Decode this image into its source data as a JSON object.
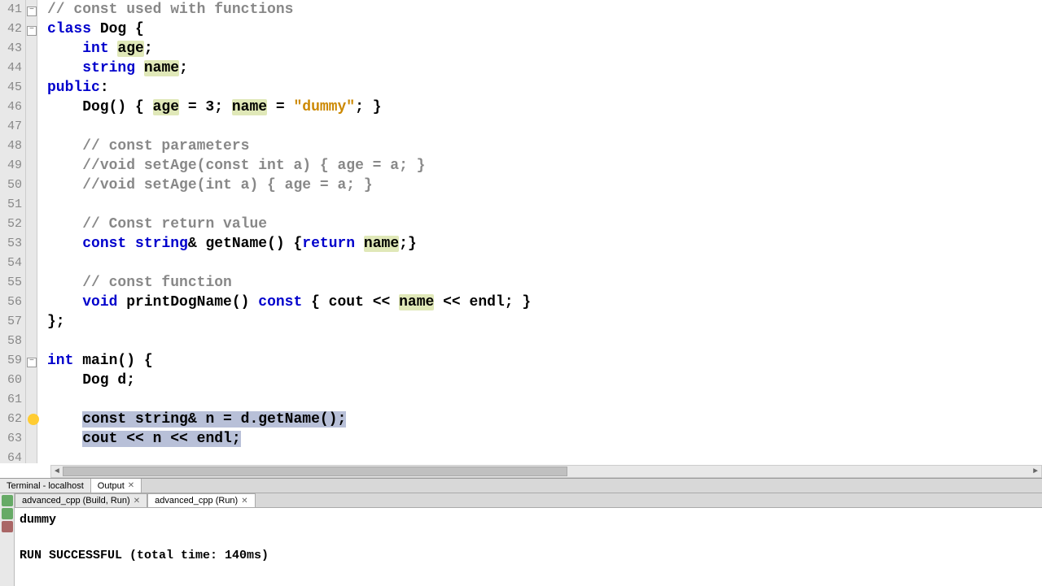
{
  "editor": {
    "lines": [
      {
        "num": 41,
        "fold": "minus",
        "tokens": [
          {
            "t": "// const used with functions",
            "c": "comment"
          }
        ]
      },
      {
        "num": 42,
        "fold": "minus",
        "tokens": [
          {
            "t": "class",
            "c": "kw"
          },
          {
            "t": " Dog {",
            "c": "ident"
          }
        ]
      },
      {
        "num": 43,
        "fold": "",
        "tokens": [
          {
            "t": "    ",
            "c": ""
          },
          {
            "t": "int",
            "c": "kw"
          },
          {
            "t": " ",
            "c": ""
          },
          {
            "t": "age",
            "c": "hl-age"
          },
          {
            "t": ";",
            "c": "ident"
          }
        ]
      },
      {
        "num": 44,
        "fold": "",
        "tokens": [
          {
            "t": "    ",
            "c": ""
          },
          {
            "t": "string",
            "c": "kw"
          },
          {
            "t": " ",
            "c": ""
          },
          {
            "t": "name",
            "c": "hl-name"
          },
          {
            "t": ";",
            "c": "ident"
          }
        ]
      },
      {
        "num": 45,
        "fold": "",
        "tokens": [
          {
            "t": "public",
            "c": "kw"
          },
          {
            "t": ":",
            "c": "ident"
          }
        ]
      },
      {
        "num": 46,
        "fold": "",
        "tokens": [
          {
            "t": "    Dog() { ",
            "c": "ident"
          },
          {
            "t": "age",
            "c": "hl-age"
          },
          {
            "t": " = 3; ",
            "c": "ident"
          },
          {
            "t": "name",
            "c": "hl-name"
          },
          {
            "t": " = ",
            "c": "ident"
          },
          {
            "t": "\"dummy\"",
            "c": "str"
          },
          {
            "t": "; }",
            "c": "ident"
          }
        ]
      },
      {
        "num": 47,
        "fold": "",
        "tokens": []
      },
      {
        "num": 48,
        "fold": "",
        "tokens": [
          {
            "t": "    ",
            "c": ""
          },
          {
            "t": "// const parameters",
            "c": "comment"
          }
        ]
      },
      {
        "num": 49,
        "fold": "",
        "tokens": [
          {
            "t": "    ",
            "c": ""
          },
          {
            "t": "//void setAge(const int a) { age = a; }",
            "c": "comment"
          }
        ]
      },
      {
        "num": 50,
        "fold": "",
        "tokens": [
          {
            "t": "    ",
            "c": ""
          },
          {
            "t": "//void setAge(int a) { age = a; }",
            "c": "comment"
          }
        ]
      },
      {
        "num": 51,
        "fold": "",
        "tokens": []
      },
      {
        "num": 52,
        "fold": "",
        "tokens": [
          {
            "t": "    ",
            "c": ""
          },
          {
            "t": "// Const return value",
            "c": "comment"
          }
        ]
      },
      {
        "num": 53,
        "fold": "",
        "tokens": [
          {
            "t": "    ",
            "c": ""
          },
          {
            "t": "const",
            "c": "kw"
          },
          {
            "t": " ",
            "c": ""
          },
          {
            "t": "string",
            "c": "kw"
          },
          {
            "t": "& getName() {",
            "c": "ident"
          },
          {
            "t": "return",
            "c": "kw"
          },
          {
            "t": " ",
            "c": ""
          },
          {
            "t": "name",
            "c": "hl-name"
          },
          {
            "t": ";}",
            "c": "ident"
          }
        ]
      },
      {
        "num": 54,
        "fold": "",
        "tokens": []
      },
      {
        "num": 55,
        "fold": "",
        "tokens": [
          {
            "t": "    ",
            "c": ""
          },
          {
            "t": "// const function",
            "c": "comment"
          }
        ]
      },
      {
        "num": 56,
        "fold": "",
        "tokens": [
          {
            "t": "    ",
            "c": ""
          },
          {
            "t": "void",
            "c": "kw"
          },
          {
            "t": " printDogName() ",
            "c": "ident"
          },
          {
            "t": "const",
            "c": "kw"
          },
          {
            "t": " { cout << ",
            "c": "ident"
          },
          {
            "t": "name",
            "c": "hl-name"
          },
          {
            "t": " << endl; }",
            "c": "ident"
          }
        ]
      },
      {
        "num": 57,
        "fold": "",
        "tokens": [
          {
            "t": "};",
            "c": "ident"
          }
        ]
      },
      {
        "num": 58,
        "fold": "",
        "tokens": []
      },
      {
        "num": 59,
        "fold": "minus",
        "tokens": [
          {
            "t": "int",
            "c": "kw"
          },
          {
            "t": " main() {",
            "c": "ident"
          }
        ]
      },
      {
        "num": 60,
        "fold": "",
        "tokens": [
          {
            "t": "    Dog d;",
            "c": "ident"
          }
        ]
      },
      {
        "num": 61,
        "fold": "",
        "tokens": []
      },
      {
        "num": 62,
        "fold": "",
        "bulb": true,
        "sel": "start",
        "tokens": [
          {
            "t": "    ",
            "c": ""
          },
          {
            "t": "const string& n = d.getName();",
            "c": "selected"
          }
        ]
      },
      {
        "num": 63,
        "fold": "",
        "sel": "cont",
        "tokens": [
          {
            "t": "    ",
            "c": ""
          },
          {
            "t": "cout << n << endl;",
            "c": "selected"
          }
        ]
      },
      {
        "num": 64,
        "fold": "",
        "tokens": []
      }
    ]
  },
  "bottom_panel": {
    "tabs": [
      {
        "label": "Terminal - localhost",
        "active": false,
        "closable": false
      },
      {
        "label": "Output",
        "active": true,
        "closable": true
      }
    ],
    "sub_tabs": [
      {
        "label": "advanced_cpp (Build, Run)",
        "active": false,
        "closable": true
      },
      {
        "label": "advanced_cpp (Run)",
        "active": true,
        "closable": true
      }
    ],
    "output_lines": [
      "dummy",
      "",
      "RUN SUCCESSFUL (total time: 140ms)"
    ]
  }
}
